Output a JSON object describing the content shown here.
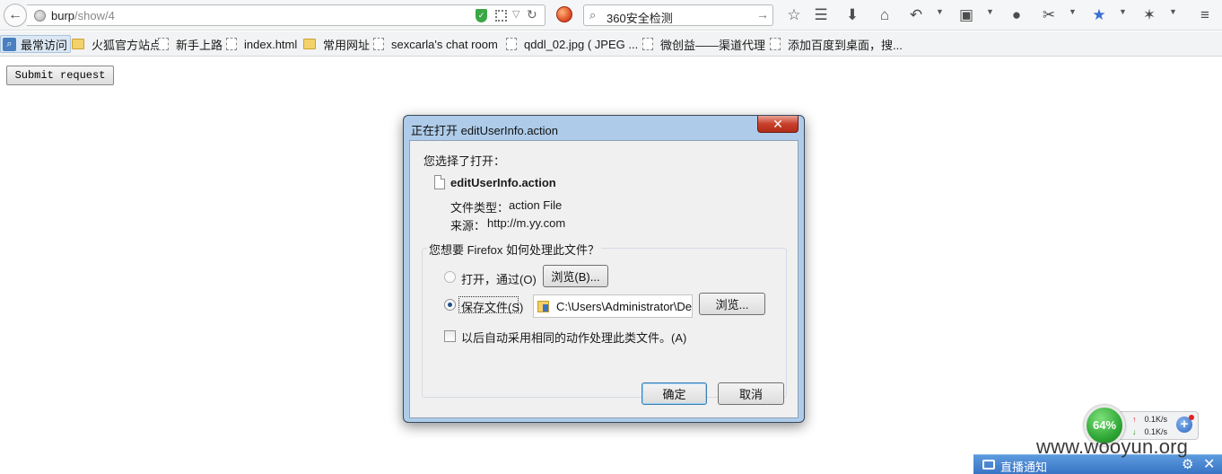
{
  "browser": {
    "url_prefix": "burp",
    "url_path": "/show/4",
    "search_text": "360安全检测"
  },
  "bookmarks": [
    {
      "label": "最常访问",
      "icon": "magnifier-icon"
    },
    {
      "label": "火狐官方站点",
      "icon": "folder-icon"
    },
    {
      "label": "新手上路",
      "icon": "page-icon"
    },
    {
      "label": "index.html",
      "icon": "page-icon"
    },
    {
      "label": "常用网址",
      "icon": "folder-icon"
    },
    {
      "label": "sexcarla's chat room",
      "icon": "page-icon"
    },
    {
      "label": "qddl_02.jpg ( JPEG ...",
      "icon": "page-icon"
    },
    {
      "label": "微创益——渠道代理",
      "icon": "page-icon"
    },
    {
      "label": "添加百度到桌面，搜...",
      "icon": "page-icon"
    }
  ],
  "page": {
    "submit_label": "Submit request"
  },
  "dialog": {
    "title": "正在打开 editUserInfo.action",
    "chosen_label": "您选择了打开：",
    "file_name": "editUserInfo.action",
    "file_type_label": "文件类型：",
    "file_type_value": "action File",
    "source_label": "来源：",
    "source_value": "http://m.yy.com",
    "group_legend": "您想要 Firefox 如何处理此文件？",
    "open_with_label": "打开，通过(O)",
    "browse_label_1": "浏览(B)...",
    "save_file_label": "保存文件(S)",
    "save_path": "C:\\Users\\Administrator\\Desktop",
    "browse_label_2": "浏览...",
    "auto_label": "以后自动采用相同的动作处理此类文件。(A)",
    "ok_label": "确定",
    "cancel_label": "取消",
    "selected_option": "save-file",
    "auto_checked": false
  },
  "netmon": {
    "percent": "64%",
    "upload": "0.1K/s",
    "download": "0.1K/s"
  },
  "notification": {
    "label": "直播通知"
  },
  "watermark": "www.wooyun.org",
  "colors": {
    "dialog_frame": "#aeccea",
    "dialog_close": "#c9402c",
    "notify_bar": "#3874c4",
    "netmon_ball": "#2fa836"
  }
}
